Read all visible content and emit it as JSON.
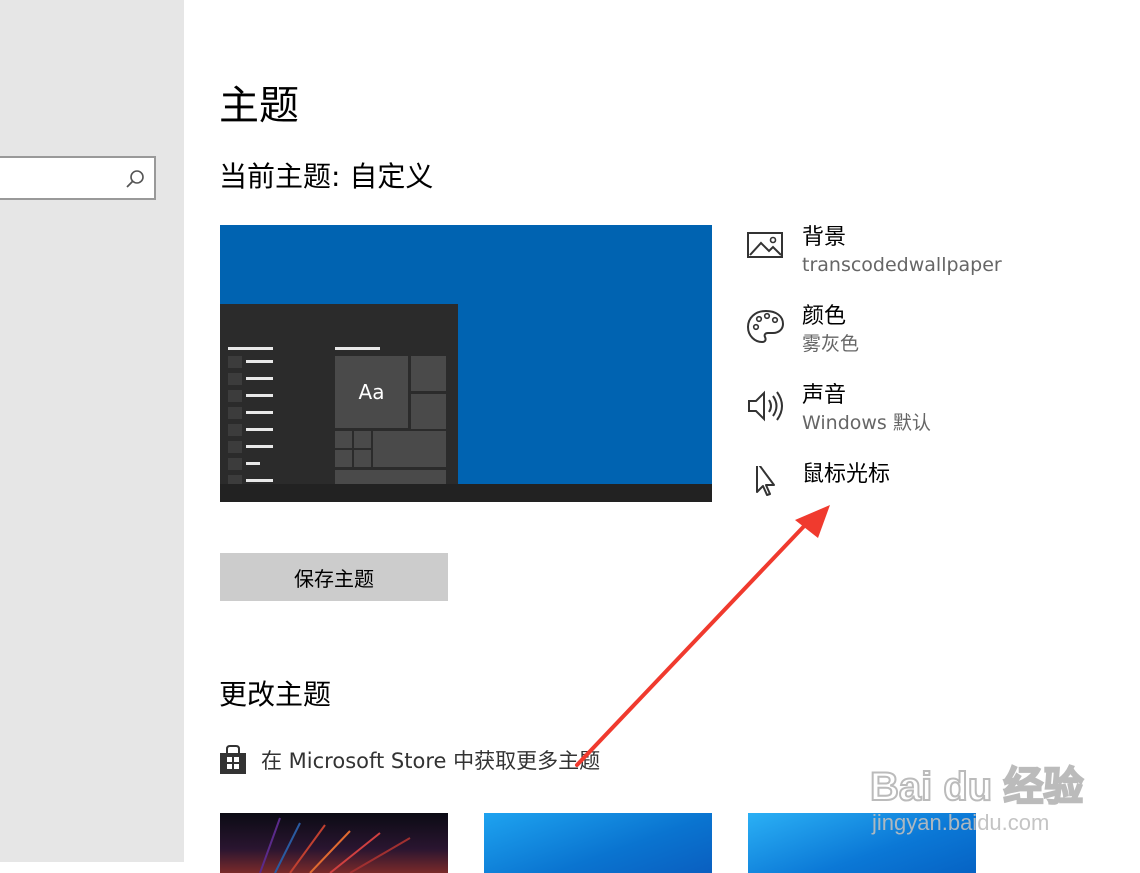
{
  "sidebar": {
    "search": {
      "placeholder": "",
      "value": "",
      "icon": "search-icon"
    }
  },
  "main": {
    "title": "主题",
    "current_theme": "当前主题: 自定义",
    "preview": {
      "tile_label": "Aa",
      "colors": {
        "desktop": "#0063b1",
        "window": "#2b2b2b"
      }
    },
    "properties": [
      {
        "label": "背景",
        "value": "transcodedwallpaper",
        "icon": "picture-icon"
      },
      {
        "label": "颜色",
        "value": "雾灰色",
        "icon": "palette-icon"
      },
      {
        "label": "声音",
        "value": "Windows 默认",
        "icon": "speaker-icon"
      },
      {
        "label": "鼠标光标",
        "value": "",
        "icon": "cursor-icon"
      }
    ],
    "save_button": "保存主题",
    "change_title": "更改主题",
    "store_link": "在 Microsoft Store 中获取更多主题"
  },
  "watermark": {
    "brand": "Bai du 经验",
    "url": "jingyan.baidu.com"
  },
  "colors": {
    "annotation_arrow": "#f03a2e",
    "sidebar_bg": "#e6e6e6",
    "button_bg": "#cccccc"
  }
}
